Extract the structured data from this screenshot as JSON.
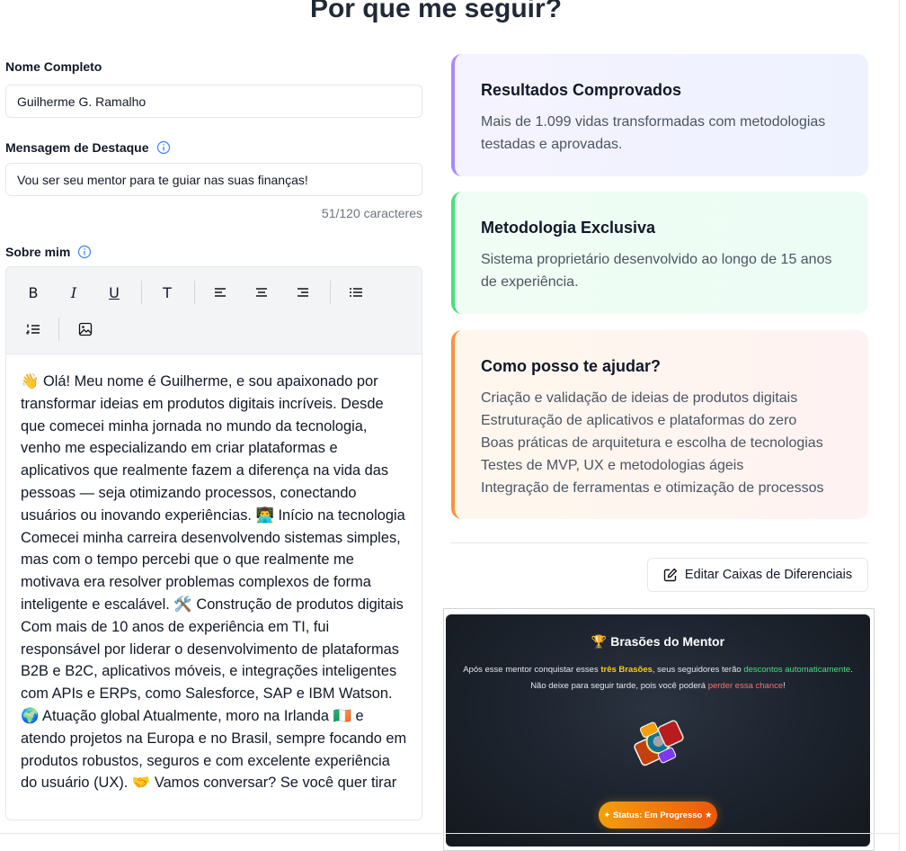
{
  "page": {
    "title": "Por que me seguir?"
  },
  "form": {
    "name_label": "Nome Completo",
    "name_value": "Guilherme G. Ramalho",
    "headline_label": "Mensagem de Destaque",
    "headline_value": "Vou ser seu mentor para te guiar nas suas finanças!",
    "headline_count": "51/120 caracteres",
    "about_label": "Sobre mim",
    "about_text": "👋 Olá! Meu nome é Guilherme, e sou apaixonado por transformar ideias em produtos digitais incríveis. Desde que comecei minha jornada no mundo da tecnologia, venho me especializando em criar plataformas e aplicativos que realmente fazem a diferença na vida das pessoas — seja otimizando processos, conectando usuários ou inovando experiências. 👨‍💻 Início na tecnologia Comecei minha carreira desenvolvendo sistemas simples, mas com o tempo percebi que o que realmente me motivava era resolver problemas complexos de forma inteligente e escalável. 🛠️ Construção de produtos digitais Com mais de 10 anos de experiência em TI, fui responsável por liderar o desenvolvimento de plataformas B2B e B2C, aplicativos móveis, e integrações inteligentes com APIs e ERPs, como Salesforce, SAP e IBM Watson. 🌍 Atuação global Atualmente, moro na Irlanda 🇮🇪 e atendo projetos na Europa e no Brasil, sempre focando em produtos robustos, seguros e com excelente experiência do usuário (UX). 🤝 Vamos conversar? Se você quer tirar"
  },
  "toolbar": {
    "bold": "B",
    "italic": "I",
    "underline": "U",
    "text_style": "T"
  },
  "cards": [
    {
      "title": "Resultados Comprovados",
      "lines": [
        "Mais de 1.099 vidas transformadas com metodologias",
        "testadas e aprovadas."
      ]
    },
    {
      "title": "Metodologia Exclusiva",
      "lines": [
        "Sistema proprietário desenvolvido ao longo de 15 anos",
        "de experiência."
      ]
    },
    {
      "title": "Como posso te ajudar?",
      "lines": [
        "Criação e validação de ideias de produtos digitais",
        "Estruturação de aplicativos e plataformas do zero",
        "Boas práticas de arquitetura e escolha de tecnologias",
        "Testes de MVP, UX e metodologias ágeis",
        "Integração de ferramentas e otimização de processos"
      ]
    }
  ],
  "edit_button": {
    "label": "Editar Caixas de Diferenciais"
  },
  "badges": {
    "title": "Brasões do Mentor",
    "desc_1": "Após esse mentor conquistar esses ",
    "desc_hl_1": "três Brasões",
    "desc_2": ", seus seguidores terão ",
    "desc_hl_2": "descontos automaticamente",
    "desc_3": ".",
    "desc_4": "Não deixe para seguir tarde, pois você poderá ",
    "desc_hl_3": "perder essa chance",
    "desc_5": "!",
    "status": "✦ Status: Em Progresso ★"
  },
  "colors": {
    "purple": "#a78bfa",
    "green": "#4ade80",
    "orange": "#fb923c",
    "status": "#f59e0b"
  }
}
